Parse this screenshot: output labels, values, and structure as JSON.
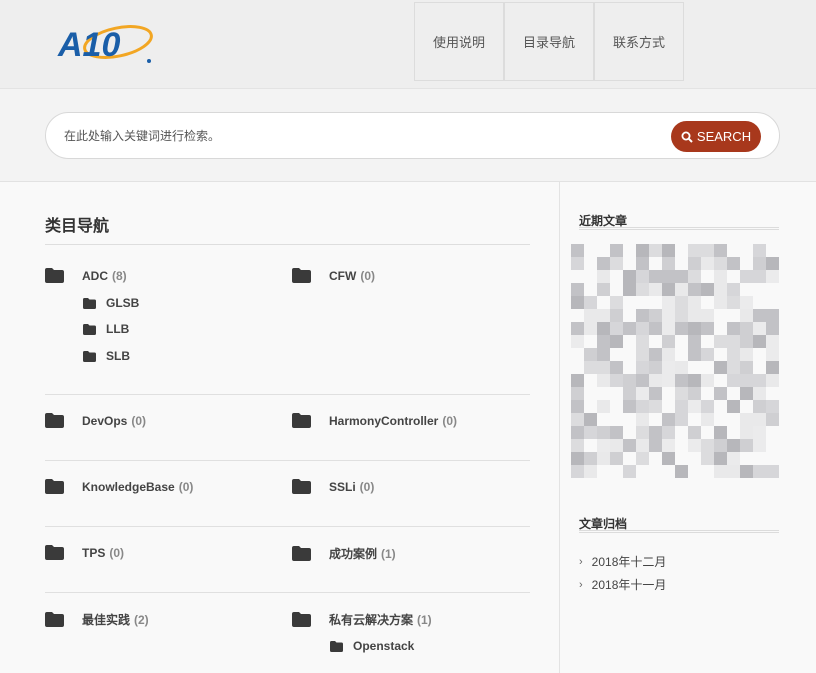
{
  "header": {
    "logo_text": "A10",
    "nav": [
      "使用说明",
      "目录导航",
      "联系方式"
    ]
  },
  "search": {
    "placeholder": "在此处输入关键词进行检索。",
    "button": "SEARCH"
  },
  "categories": {
    "title": "类目导航",
    "rows": [
      [
        {
          "name": "ADC",
          "count": "(8)",
          "children": [
            "GLSB",
            "LLB",
            "SLB"
          ]
        },
        {
          "name": "CFW",
          "count": "(0)",
          "children": []
        }
      ],
      [
        {
          "name": "DevOps",
          "count": "(0)",
          "children": []
        },
        {
          "name": "HarmonyController",
          "count": "(0)",
          "children": []
        }
      ],
      [
        {
          "name": "KnowledgeBase",
          "count": "(0)",
          "children": []
        },
        {
          "name": "SSLi",
          "count": "(0)",
          "children": []
        }
      ],
      [
        {
          "name": "TPS",
          "count": "(0)",
          "children": []
        },
        {
          "name": "成功案例",
          "count": "(1)",
          "children": []
        }
      ],
      [
        {
          "name": "最佳实践",
          "count": "(2)",
          "children": []
        },
        {
          "name": "私有云解决方案",
          "count": "(1)",
          "children": [
            "Openstack"
          ]
        }
      ]
    ]
  },
  "sidebar": {
    "recent_title": "近期文章",
    "archive_title": "文章归档",
    "archives": [
      "2018年十二月",
      "2018年十一月"
    ]
  },
  "colors": {
    "accent": "#a8381c",
    "logo_blue": "#1a5ea8",
    "logo_orange": "#f2a623"
  }
}
